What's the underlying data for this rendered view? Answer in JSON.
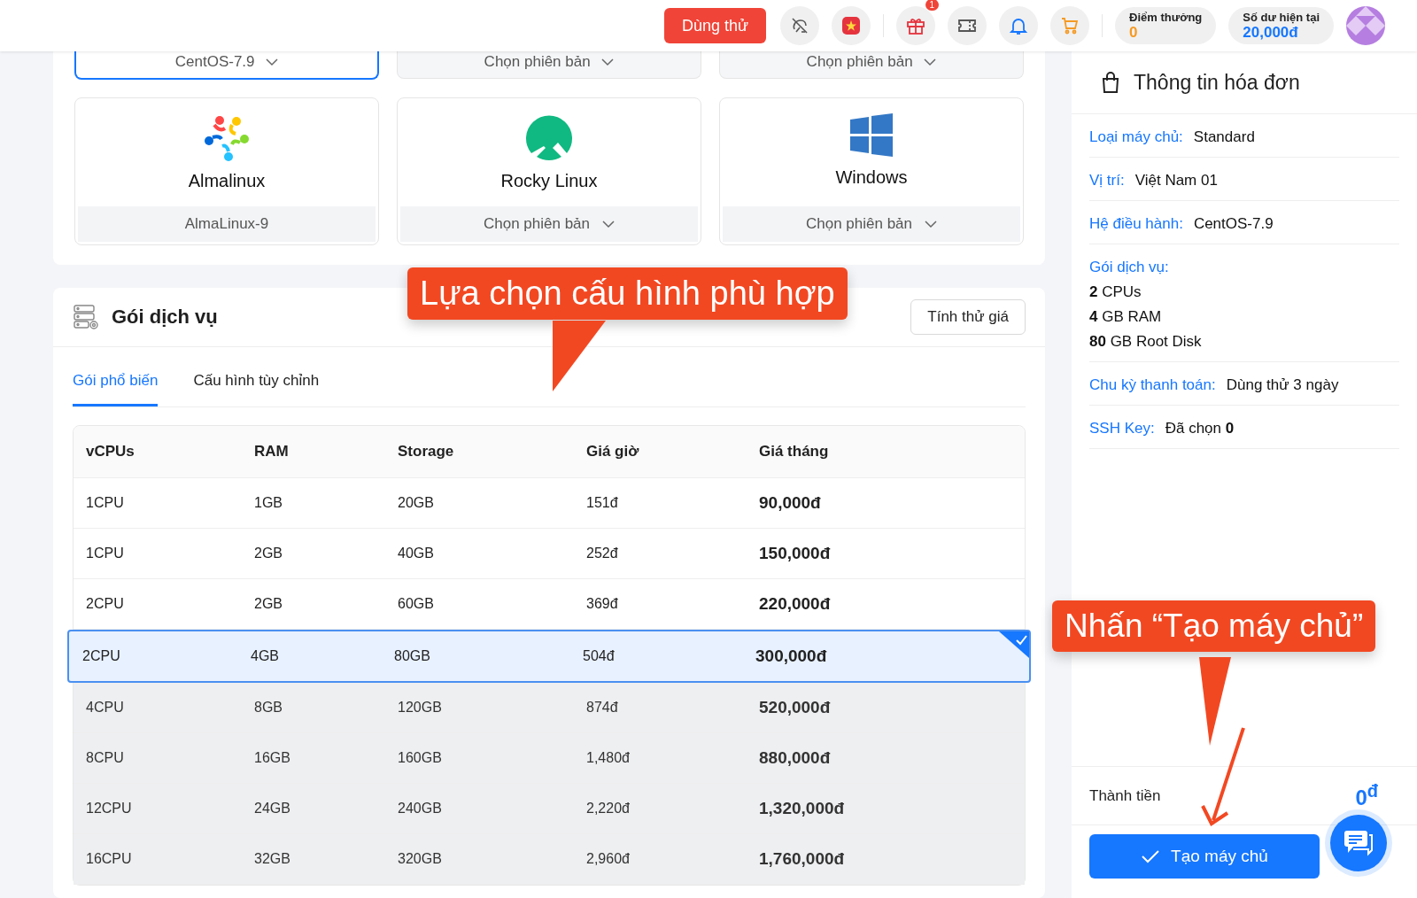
{
  "header": {
    "try_button": "Dùng thử",
    "gift_badge": "1",
    "points": {
      "label": "Điểm thưởng",
      "value": "0"
    },
    "balance": {
      "label": "Số dư hiện tại",
      "value": "20,000đ"
    }
  },
  "os_top_row": [
    {
      "version": "CentOS-7.9",
      "selected": true
    },
    {
      "version": "Chọn phiên bản",
      "selected": false
    },
    {
      "version": "Chọn phiên bản",
      "selected": false
    }
  ],
  "os_cards": [
    {
      "name": "Almalinux",
      "version": "AlmaLinux-9",
      "selected": false
    },
    {
      "name": "Rocky Linux",
      "version": "Chọn phiên bản",
      "selected": false
    },
    {
      "name": "Windows",
      "version": "Chọn phiên bản",
      "selected": false
    }
  ],
  "service": {
    "title": "Gói dịch vụ",
    "estimate_button": "Tính thử giá",
    "tabs": [
      {
        "label": "Gói phổ biến",
        "selected": true
      },
      {
        "label": "Cấu hình tùy chỉnh",
        "selected": false
      }
    ],
    "table": {
      "columns": [
        "vCPUs",
        "RAM",
        "Storage",
        "Giá giờ",
        "Giá tháng"
      ],
      "rows": [
        {
          "cells": [
            "1CPU",
            "1GB",
            "20GB",
            "151đ",
            "90,000đ"
          ],
          "selected": false,
          "disabled": false
        },
        {
          "cells": [
            "1CPU",
            "2GB",
            "40GB",
            "252đ",
            "150,000đ"
          ],
          "selected": false,
          "disabled": false
        },
        {
          "cells": [
            "2CPU",
            "2GB",
            "60GB",
            "369đ",
            "220,000đ"
          ],
          "selected": false,
          "disabled": false
        },
        {
          "cells": [
            "2CPU",
            "4GB",
            "80GB",
            "504đ",
            "300,000đ"
          ],
          "selected": true,
          "disabled": false
        },
        {
          "cells": [
            "4CPU",
            "8GB",
            "120GB",
            "874đ",
            "520,000đ"
          ],
          "selected": false,
          "disabled": true
        },
        {
          "cells": [
            "8CPU",
            "16GB",
            "160GB",
            "1,480đ",
            "880,000đ"
          ],
          "selected": false,
          "disabled": true
        },
        {
          "cells": [
            "12CPU",
            "24GB",
            "240GB",
            "2,220đ",
            "1,320,000đ"
          ],
          "selected": false,
          "disabled": true
        },
        {
          "cells": [
            "16CPU",
            "32GB",
            "320GB",
            "2,960đ",
            "1,760,000đ"
          ],
          "selected": false,
          "disabled": true
        }
      ]
    }
  },
  "invoice": {
    "title": "Thông tin hóa đơn",
    "fields": [
      {
        "kind": "inline",
        "label": "Loại máy chủ:",
        "value": "Standard"
      },
      {
        "kind": "inline",
        "label": "Vị trí:",
        "value": "Việt Nam 01"
      },
      {
        "kind": "inline",
        "label": "Hệ điều hành:",
        "value": "CentOS-7.9"
      },
      {
        "kind": "list",
        "label": "Gói dịch vụ:",
        "lines": [
          "**2** CPUs",
          "**4** GB RAM",
          "**80** GB Root Disk"
        ]
      },
      {
        "kind": "inline",
        "label": "Chu kỳ thanh toán:",
        "value": "Dùng thử 3 ngày"
      },
      {
        "kind": "inline",
        "label": "SSH Key:",
        "value": "Đã chọn **0**"
      }
    ],
    "total_label": "Thành tiền",
    "total_value": "0$^{đ}$",
    "create_button": "Tạo máy chủ"
  },
  "annotations": [
    {
      "text": "Lựa chọn cấu hình phù hợp"
    },
    {
      "text": "Nhấn “Tạo máy chủ”"
    }
  ]
}
